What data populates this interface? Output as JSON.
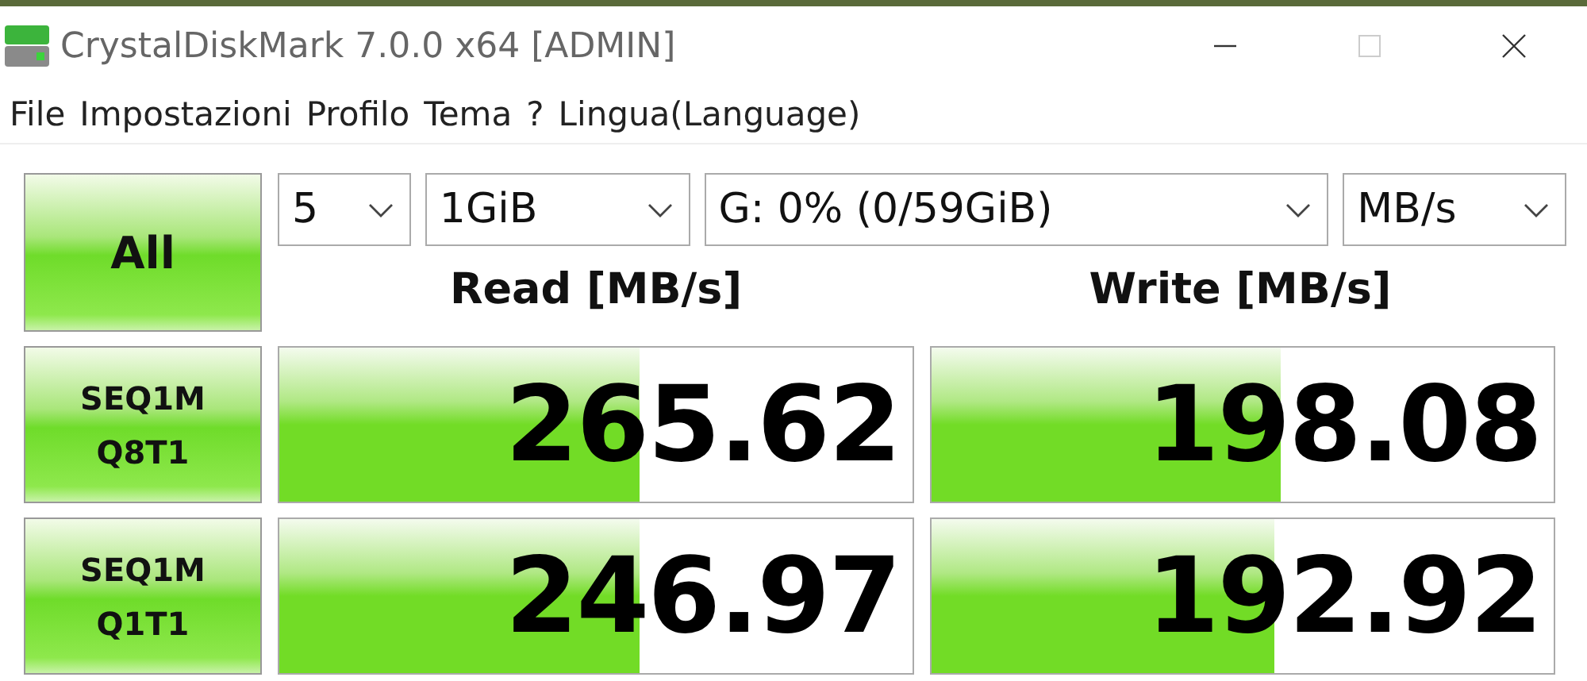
{
  "window": {
    "title": "CrystalDiskMark 7.0.0 x64 [ADMIN]"
  },
  "menu": [
    "File",
    "Impostazioni",
    "Profilo",
    "Tema",
    "?",
    "Lingua(Language)"
  ],
  "all_button": "All",
  "selects": [
    {
      "value": "5"
    },
    {
      "value": "1GiB"
    },
    {
      "value": "G: 0% (0/59GiB)"
    },
    {
      "value": "MB/s"
    }
  ],
  "headers": [
    "Read [MB/s]",
    "Write [MB/s]"
  ],
  "rows": [
    {
      "label": [
        "SEQ1M",
        "Q8T1"
      ],
      "read": {
        "value": "265.62",
        "level": 0.57
      },
      "write": {
        "value": "198.08",
        "level": 0.56
      }
    },
    {
      "label": [
        "SEQ1M",
        "Q1T1"
      ],
      "read": {
        "value": "246.97",
        "level": 0.57
      },
      "write": {
        "value": "192.92",
        "level": 0.55
      }
    }
  ]
}
